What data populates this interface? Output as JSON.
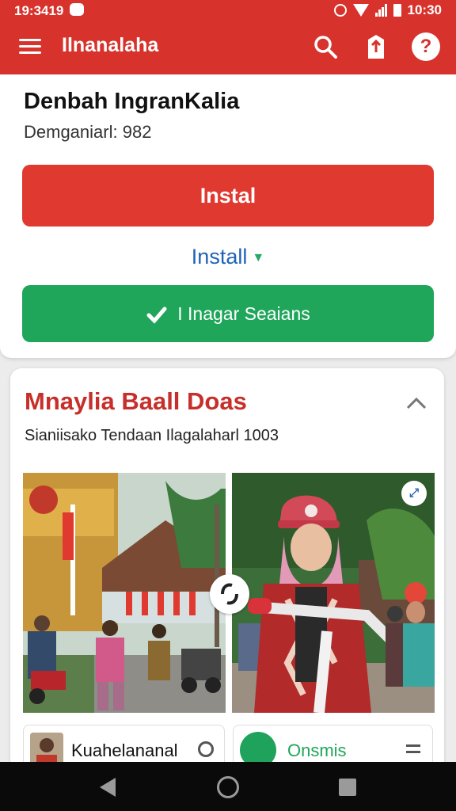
{
  "status_bar": {
    "time": "19:3419",
    "right_time": "10:30"
  },
  "app_bar": {
    "title": "Ilnanalaha"
  },
  "app_card": {
    "name": "Denbah IngranKalia",
    "subtitle": "Demganiarl: 982",
    "install_button": "Instal",
    "install_link": "Install",
    "manage_button": "I Inagar Seaians"
  },
  "gallery": {
    "title": "Mnaylia Baall Doas",
    "subtitle": "Sianiisako Tendaan Ilagalaharl 1003",
    "tiles": [
      {
        "label": "Kuahelananal"
      },
      {
        "label": "Onsmis"
      }
    ]
  },
  "colors": {
    "app_bar": "#d7322c",
    "install_button": "#e0392f",
    "link_blue": "#1f63b6",
    "manage_button": "#20a65a",
    "gallery_title": "#c62f2a",
    "nav_bar": "#0a0a0a"
  },
  "icons": {
    "app_bar": [
      "menu-icon",
      "search-icon",
      "share-icon",
      "help-icon"
    ],
    "nav": [
      "back-icon",
      "home-icon",
      "recents-icon"
    ]
  }
}
